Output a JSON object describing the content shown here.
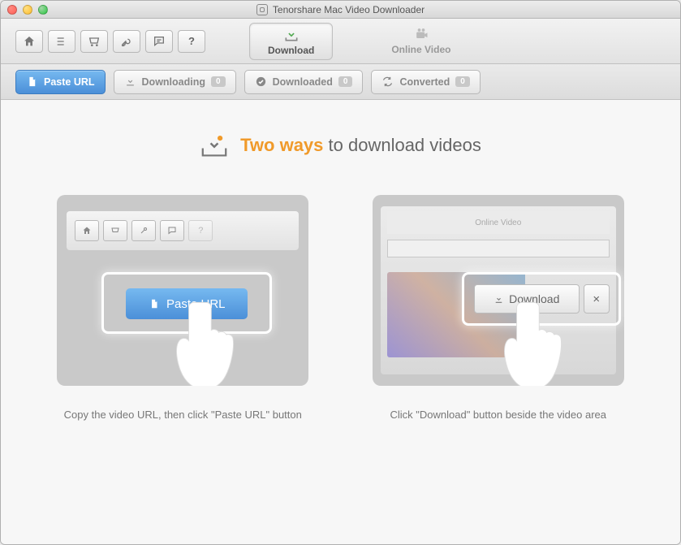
{
  "window": {
    "title": "Tenorshare Mac Video Downloader"
  },
  "tabs": {
    "download": "Download",
    "online_video": "Online Video"
  },
  "filters": {
    "paste_url": "Paste URL",
    "downloading": "Downloading",
    "downloading_count": "0",
    "downloaded": "Downloaded",
    "downloaded_count": "0",
    "converted": "Converted",
    "converted_count": "0"
  },
  "headline": {
    "orange": "Two ways",
    "rest": " to download videos"
  },
  "cards": {
    "left": {
      "chip_label": "Paste URL",
      "caption": "Copy the video URL, then click \"Paste URL\" button"
    },
    "right": {
      "header_item": "Online Video",
      "chip_label": "Download",
      "close": "×",
      "caption": "Click \"Download\" button beside the video area"
    }
  }
}
